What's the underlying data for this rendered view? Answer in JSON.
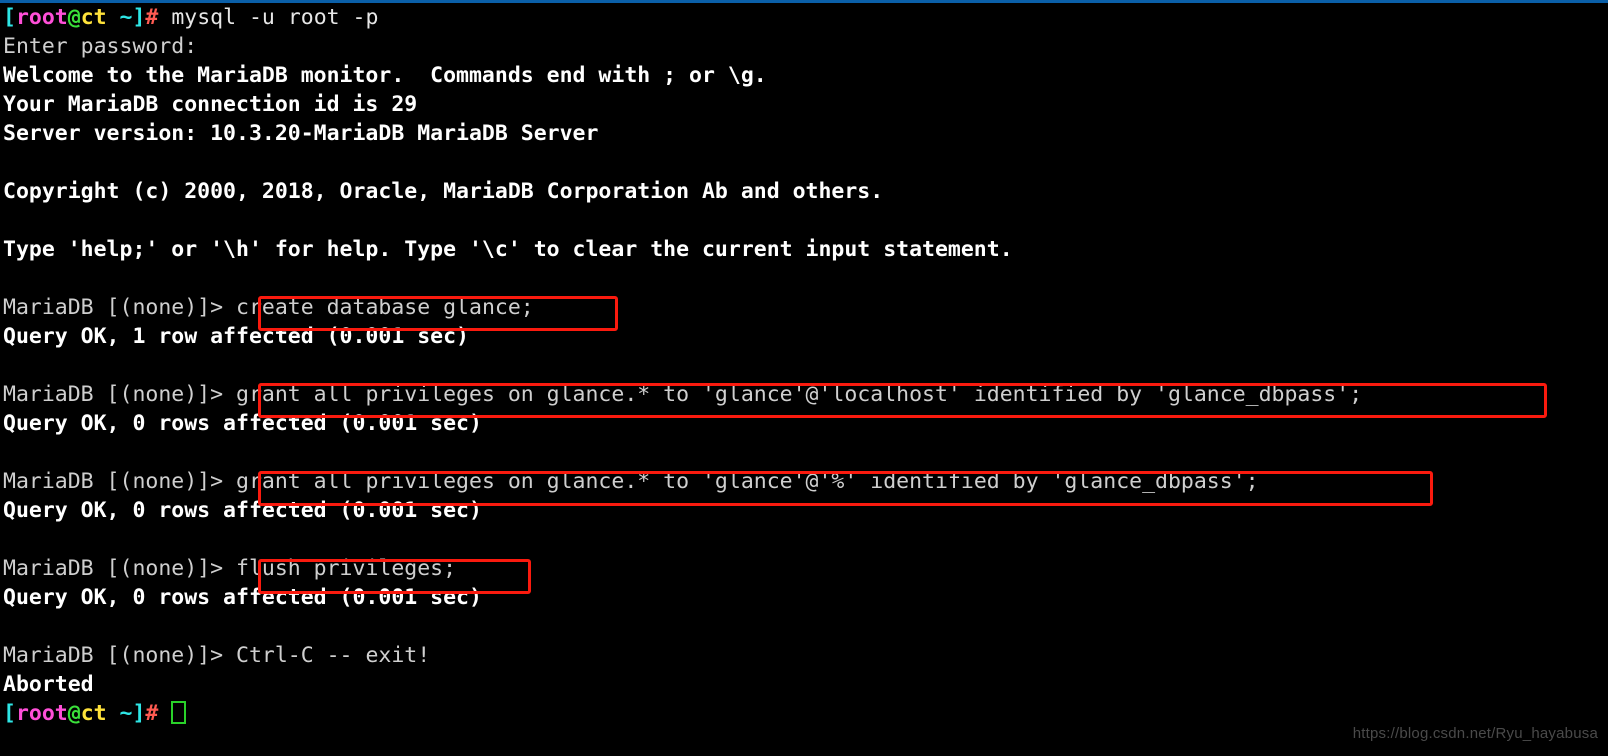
{
  "terminal": {
    "title": "root@ct terminal - MariaDB session",
    "top_accent_color": "#0a5fa8",
    "background_color": "#000000",
    "highlight_box_color": "#fa1a0e",
    "cursor_color": "#29d129",
    "prompt": {
      "bracket_open": "[",
      "user": "root",
      "at": "@",
      "host": "ct",
      "path_close": " ~]",
      "sigil": "#"
    },
    "lines": {
      "l1_command": " mysql -u root -p",
      "l2": "Enter password:",
      "l3": "Welcome to the MariaDB monitor.  Commands end with ; or \\g.",
      "l4": "Your MariaDB connection id is 29",
      "l5": "Server version: 10.3.20-MariaDB MariaDB Server",
      "l6": "",
      "l7": "Copyright (c) 2000, 2018, Oracle, MariaDB Corporation Ab and others.",
      "l8": "",
      "l9": "Type 'help;' or '\\h' for help. Type '\\c' to clear the current input statement.",
      "l10": "",
      "mariadb_prompt": "MariaDB [(none)]> ",
      "cmd1": "create database glance;",
      "res1": "Query OK, 1 row affected (0.001 sec)",
      "cmd2": "grant all privileges on glance.* to 'glance'@'localhost' identified by 'glance_dbpass';",
      "res2": "Query OK, 0 rows affected (0.001 sec)",
      "cmd3": "grant all privileges on glance.* to 'glance'@'%' identified by 'glance_dbpass';",
      "res3": "Query OK, 0 rows affected (0.001 sec)",
      "cmd4": "flush privileges;",
      "res4": "Query OK, 0 rows affected (0.001 sec)",
      "exit_line": "Ctrl-C -- exit!",
      "aborted": "Aborted"
    },
    "watermark": "https://blog.csdn.net/Ryu_hayabusa"
  }
}
